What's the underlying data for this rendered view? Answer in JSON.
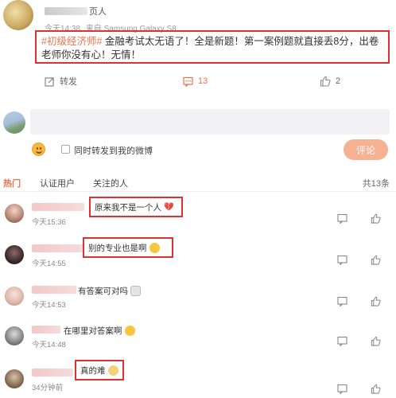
{
  "post": {
    "author_suffix": "页人",
    "time": "今天14:38",
    "source": "来自 Samsung Galaxy S8",
    "hashtag": "#初级经济师#",
    "text": " 金融考试太无语了！全是新题！第一案例题就直接丢8分，出卷老师你没有心！无情！",
    "actions": {
      "forward_label": "转发",
      "comment_count": "13",
      "like_count": "2"
    }
  },
  "compose": {
    "placeholder": "",
    "forward_checkbox_label": "同时转发到我的微博",
    "submit_label": "评论"
  },
  "tabs": {
    "hot": "热门",
    "certified": "认证用户",
    "followed": "关注的人",
    "count": "共13条"
  },
  "comments": [
    {
      "time": "今天15:36",
      "text": "原来我不是一个人",
      "emoji": "broken-heart",
      "highlighted": true
    },
    {
      "time": "今天14:55",
      "text": "别的专业也是啊",
      "emoji": "crying-face",
      "highlighted": true
    },
    {
      "time": "今天14:53",
      "text": "有答案可对吗",
      "emoji": "sad-face",
      "highlighted": false
    },
    {
      "time": "今天14:48",
      "text": "在哪里对答案啊",
      "emoji": "crying-face",
      "highlighted": false
    },
    {
      "time": "34分钟前",
      "text": "真的难",
      "emoji": "sweat-face",
      "highlighted": true
    }
  ],
  "colors": {
    "accent": "#eb7350",
    "highlight_box": "#e03030",
    "submit_bg": "#f7b193"
  }
}
